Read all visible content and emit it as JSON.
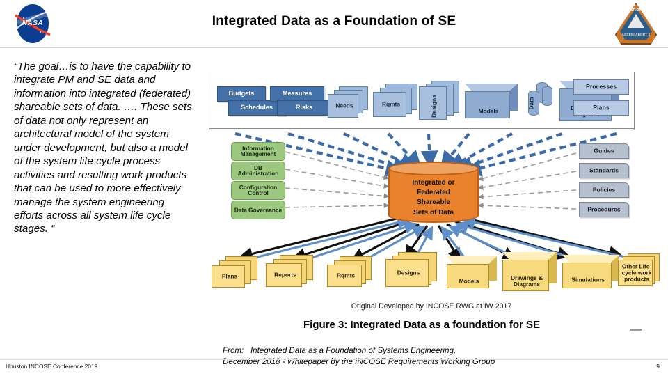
{
  "header": {
    "title": "Integrated Data as a Foundation of SE",
    "nasa_logo_text": "NASA",
    "orion_patch_top_text": "ORION",
    "orion_patch_bottom_text": "ASCENI ABORT 2"
  },
  "quote": {
    "text": "“The goal…is to have the capability to integrate PM and SE data and information into integrated (federated) shareable sets of data. …. These sets of data not only represent an architectural model of the system under development, but also a model of the system life cycle process activities and resulting work products that can be used to more effectively manage the system engineering efforts across all system life cycle stages. “"
  },
  "figure": {
    "top_row": [
      {
        "label": "Budgets",
        "style": "blue-flat"
      },
      {
        "label": "Schedules",
        "style": "blue-flat"
      },
      {
        "label": "Measures",
        "style": "blue-flat"
      },
      {
        "label": "Risks",
        "style": "blue-flat"
      },
      {
        "label": "Needs",
        "style": "doc-stack"
      },
      {
        "label": "Rqmts",
        "style": "doc-stack"
      },
      {
        "label": "Designs",
        "style": "doc-stack"
      },
      {
        "label": "Models",
        "style": "box3d"
      },
      {
        "label": "Data",
        "style": "cylinders"
      },
      {
        "label": "Drawings & Diagrams",
        "style": "box3d"
      },
      {
        "label": "Processes",
        "style": "blue-plain"
      },
      {
        "label": "Plans",
        "style": "blue-plain"
      }
    ],
    "left_column": [
      {
        "label": "Information Management"
      },
      {
        "label": "DB Administration"
      },
      {
        "label": "Configuration Control"
      },
      {
        "label": "Data Governance"
      }
    ],
    "right_column": [
      {
        "label": "Guides"
      },
      {
        "label": "Standards"
      },
      {
        "label": "Policies"
      },
      {
        "label": "Procedures"
      }
    ],
    "core": {
      "line1": "Integrated or",
      "line2": "Federated",
      "line3": "Shareable",
      "line4": "Sets of Data"
    },
    "bottom_row": [
      {
        "label": "Plans",
        "style": "y-stack"
      },
      {
        "label": "Reports",
        "style": "y-stack"
      },
      {
        "label": "Rqmts",
        "style": "y-stack"
      },
      {
        "label": "Designs",
        "style": "y-stack"
      },
      {
        "label": "Models",
        "style": "ybox"
      },
      {
        "label": "Drawings & Diagrams",
        "style": "ybox"
      },
      {
        "label": "Simulations",
        "style": "ybox"
      },
      {
        "label": "Other Life-cycle work products",
        "style": "y-stack"
      }
    ],
    "origin_credit": "Original Developed by INCOSE RWG at IW 2017",
    "caption": "Figure 3: Integrated Data as a foundation for SE",
    "colors": {
      "core_fill": "#e8822c",
      "input_blue": "#4472a8",
      "governance_green": "#9cc77f",
      "guidance_gray": "#b6bfcd",
      "output_yellow": "#f7d97e",
      "blue_arrow": "#4472a8"
    }
  },
  "source": {
    "from_label": "From:",
    "line1": "Integrated Data as a Foundation of Systems Engineering,",
    "line2": "December 2018 - Whitepaper by the INCOSE Requirements Working Group"
  },
  "footer": {
    "left_text": "Houston INCOSE Conference 2019",
    "page_number": "9"
  }
}
